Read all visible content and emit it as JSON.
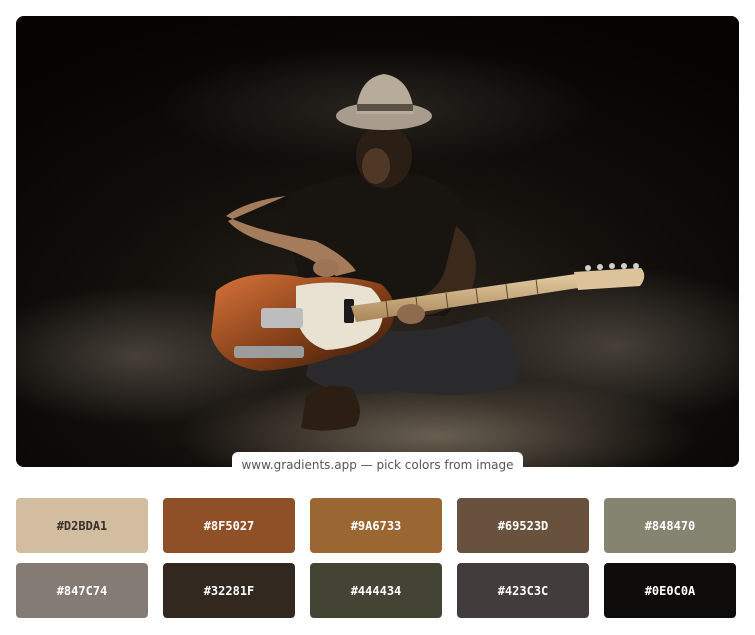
{
  "image": {
    "subject": "guitarist-with-hat-seated-in-smoke",
    "caption": "www.gradients.app — pick colors from image"
  },
  "palette": [
    {
      "hex": "#D2BDA1",
      "text_color": "#3a3128"
    },
    {
      "hex": "#8F5027",
      "text_color": "#ffffff"
    },
    {
      "hex": "#9A6733",
      "text_color": "#ffffff"
    },
    {
      "hex": "#69523D",
      "text_color": "#ffffff"
    },
    {
      "hex": "#848470",
      "text_color": "#ffffff"
    },
    {
      "hex": "#847C74",
      "text_color": "#ffffff"
    },
    {
      "hex": "#32281F",
      "text_color": "#ffffff"
    },
    {
      "hex": "#444434",
      "text_color": "#ffffff"
    },
    {
      "hex": "#423C3C",
      "text_color": "#ffffff"
    },
    {
      "hex": "#0E0C0A",
      "text_color": "#ffffff"
    }
  ]
}
